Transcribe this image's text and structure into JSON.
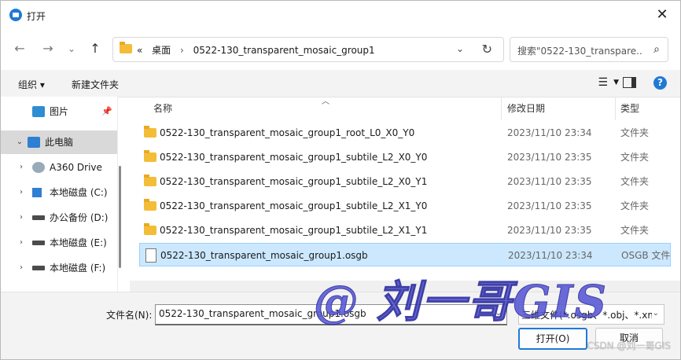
{
  "window": {
    "title": "打开",
    "close_glyph": "✕"
  },
  "nav": {
    "back": "←",
    "forward": "→",
    "history": "⌄",
    "up": "↑",
    "address_overflow": "«",
    "crumbs": [
      "桌面",
      "0522-130_transparent_mosaic_group1"
    ],
    "crumb_sep": "›",
    "search_placeholder": "搜索\"0522-130_transpare...",
    "search_icon": "⌕"
  },
  "toolbar": {
    "organize": "组织 ▾",
    "new_folder": "新建文件夹",
    "help": "?"
  },
  "sidebar": {
    "items": [
      {
        "label": "图片",
        "icon": "pictures-icon",
        "pin": "📌"
      },
      {
        "label": "此电脑",
        "icon": "pc-icon",
        "expand": "⌄",
        "selected": true
      },
      {
        "label": "A360 Drive",
        "icon": "cloud-drive-icon",
        "expand": "›"
      },
      {
        "label": "本地磁盘 (C:)",
        "icon": "windows-drive-icon",
        "expand": "›"
      },
      {
        "label": "办公备份 (D:)",
        "icon": "drive-icon",
        "expand": "›"
      },
      {
        "label": "本地磁盘 (E:)",
        "icon": "drive-icon",
        "expand": "›"
      },
      {
        "label": "本地磁盘 (F:)",
        "icon": "drive-icon",
        "expand": "›"
      }
    ]
  },
  "file_list": {
    "columns": [
      "名称",
      "修改日期",
      "类型"
    ],
    "rows": [
      {
        "name": "0522-130_transparent_mosaic_group1_root_L0_X0_Y0",
        "date": "2023/11/10 23:34",
        "type": "文件夹",
        "kind": "folder"
      },
      {
        "name": "0522-130_transparent_mosaic_group1_subtile_L2_X0_Y0",
        "date": "2023/11/10 23:35",
        "type": "文件夹",
        "kind": "folder"
      },
      {
        "name": "0522-130_transparent_mosaic_group1_subtile_L2_X0_Y1",
        "date": "2023/11/10 23:35",
        "type": "文件夹",
        "kind": "folder"
      },
      {
        "name": "0522-130_transparent_mosaic_group1_subtile_L2_X1_Y0",
        "date": "2023/11/10 23:35",
        "type": "文件夹",
        "kind": "folder"
      },
      {
        "name": "0522-130_transparent_mosaic_group1_subtile_L2_X1_Y1",
        "date": "2023/11/10 23:35",
        "type": "文件夹",
        "kind": "folder"
      },
      {
        "name": "0522-130_transparent_mosaic_group1.osgb",
        "date": "2023/11/10 23:34",
        "type": "OSGB 文件",
        "kind": "file",
        "selected": true
      }
    ]
  },
  "bottom": {
    "filename_label": "文件名(N):",
    "filename_value": "0522-130_transparent_mosaic_group1.osgb",
    "filetype_value": "三维文件(*.osgb、*.obj、*.xml",
    "open_button": "打开(O)",
    "cancel_button": "取消"
  },
  "overlay": {
    "watermark": "@ 刘一哥GIS",
    "csdn": "CSDN @刘一哥GIS"
  },
  "colors": {
    "accent": "#1f7ad6",
    "selection": "#cce8ff",
    "folder": "#f4bd38"
  }
}
